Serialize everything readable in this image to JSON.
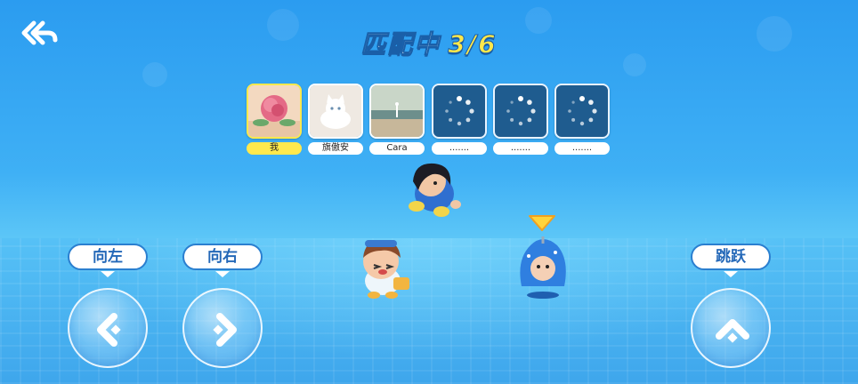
{
  "header": {
    "title": "匹配中",
    "count": "3/6"
  },
  "players": [
    {
      "name": "我",
      "status": "joined",
      "is_me": true
    },
    {
      "name": "旗傲安",
      "status": "joined",
      "is_me": false
    },
    {
      "name": "Cara",
      "status": "joined",
      "is_me": false
    },
    {
      "name": ".......",
      "status": "waiting",
      "is_me": false
    },
    {
      "name": ".......",
      "status": "waiting",
      "is_me": false
    },
    {
      "name": ".......",
      "status": "waiting",
      "is_me": false
    }
  ],
  "controls": {
    "left_label": "向左",
    "right_label": "向右",
    "jump_label": "跳跃"
  },
  "icons": {
    "back": "back-arrow-icon",
    "spinner": "loading-spinner-icon",
    "left": "left-arrow-icon",
    "right": "right-arrow-icon",
    "jump": "up-arrow-icon",
    "indicator": "yellow-triangle-icon"
  },
  "colors": {
    "accent_yellow": "#ffe94d",
    "title_blue": "#1a5fa8",
    "label_blue": "#2468b8"
  }
}
